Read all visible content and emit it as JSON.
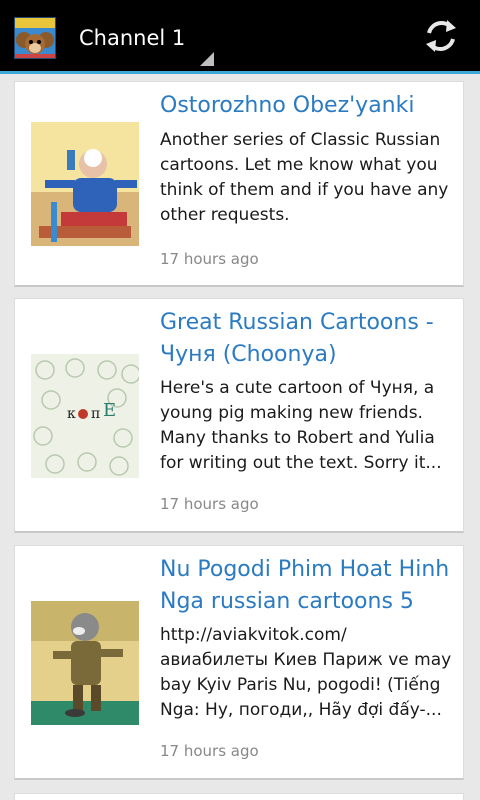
{
  "actionbar": {
    "channel_title": "Channel 1",
    "app_icon_name": "cheburashka-app-icon",
    "refresh_icon_name": "refresh-icon",
    "accent_color": "#3fa7d6"
  },
  "feed": {
    "items": [
      {
        "title": "Ostorozhno Obez'yanki",
        "description": "Another series of Classic Russian cartoons. Let me know what you think of them and if you have any other requests.",
        "time": "17 hours ago"
      },
      {
        "title": "Great Russian Cartoons - Чуня (Choonya)",
        "description": "Here's a cute cartoon of Чуня, a young pig making new friends. Many thanks to Robert and Yulia for writing out the text. Sorry it...",
        "time": "17 hours ago"
      },
      {
        "title": "Nu Pogodi Phim Hoat Hinh Nga russian cartoons 5",
        "description": "http://aviakvitok.com/ авиабилеты Киев Париж ve may bay Kyiv Paris Nu, pogodi! (Tiếng Nga: Ну, погоди,, Hãy đợi đấy-...",
        "time": "17 hours ago"
      }
    ]
  },
  "colors": {
    "title_link": "#2b7bc2",
    "time_text": "#888888",
    "background": "#e8e8e8"
  }
}
